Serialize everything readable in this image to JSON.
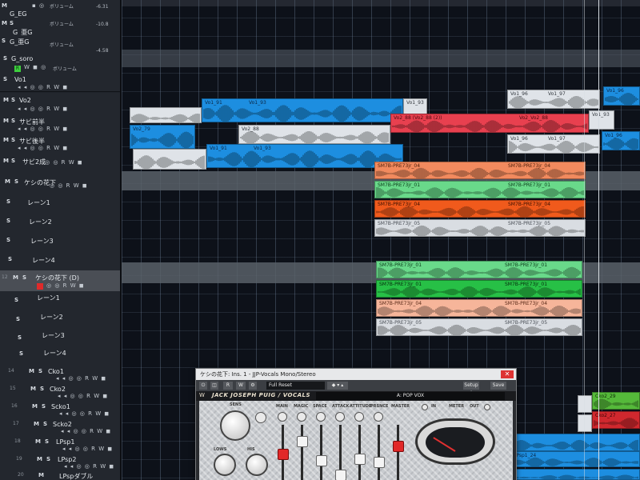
{
  "tracks": [
    {
      "name": "G_EG",
      "sub": "ボリューム",
      "value": "-6.31"
    },
    {
      "name": "G_亜G",
      "sub": "ボリューム",
      "value": "-10.8"
    },
    {
      "name": "G_亜G",
      "sub": "ボリューム",
      "value": "-4.58"
    },
    {
      "name": "G_soro",
      "sub": "ボリューム"
    },
    {
      "name": "Vo1"
    },
    {
      "name": "Vo2"
    },
    {
      "name": "サビ前半"
    },
    {
      "name": "サビ後半"
    },
    {
      "name": "サビ2成"
    },
    {
      "name": "ケシの花下"
    },
    {
      "name": "レーン1"
    },
    {
      "name": "レーン2"
    },
    {
      "name": "レーン3"
    },
    {
      "name": "レーン4"
    },
    {
      "name": "ケシの花下 (D)",
      "num": "12"
    },
    {
      "name": "レーン1"
    },
    {
      "name": "レーン2"
    },
    {
      "name": "レーン3"
    },
    {
      "name": "レーン4"
    },
    {
      "name": "Cko1",
      "num": "14"
    },
    {
      "name": "Cko2",
      "num": "15"
    },
    {
      "name": "Scko1",
      "num": "16"
    },
    {
      "name": "Scko2",
      "num": "17"
    },
    {
      "name": "LPsp1",
      "num": "18"
    },
    {
      "name": "LPsp2",
      "num": "19"
    },
    {
      "name": "LPspダブル",
      "num": "20"
    }
  ],
  "track_buttons": {
    "mute": "M",
    "solo": "S",
    "read": "R",
    "write": "W",
    "rec_lamp": "R"
  },
  "clips": [
    {
      "label": "Vo1_91",
      "label2": "Vo1_93"
    },
    {
      "label": "Vo1_93"
    },
    {
      "label": "Vo1_96",
      "label2": "Vo1_97"
    },
    {
      "label": "Vo1_96"
    },
    {
      "label": "Vo2_79"
    },
    {
      "label": "Vo2_88"
    },
    {
      "label": "Vo2_88 (Vo2_88 (2))",
      "label2": "Vo2_Vo2_88"
    },
    {
      "label": "Vo1_93"
    },
    {
      "label": "Vo1_91",
      "label2": "Vo1_93"
    },
    {
      "label": "Vo1_96",
      "label2": "Vo1_97"
    },
    {
      "label": "Vo1_96"
    },
    {
      "label": "SM7B-PRE73jr_04",
      "label2": "SM7B-PRE73jr_04"
    },
    {
      "label": "SM7B-PRE73jr_01",
      "label2": "SM7B-PRE73jr_01"
    },
    {
      "label": "SM7B-PRE73jr_04",
      "label2": "SM7B-PRE73jr_04"
    },
    {
      "label": "SM7B-PRE73jr_05",
      "label2": "SM7B-PRE73jr_05"
    },
    {
      "label": "SM7B-PRE73jr_01",
      "label2": "SM7B-PRE73jr_01"
    },
    {
      "label": "SM7B-PRE73jr_01",
      "label2": "SM7B-PRE73jr_01"
    },
    {
      "label": "SM7B-PRE73jr_04",
      "label2": "SM7B-PRE73jr_04"
    },
    {
      "label": "SM7B-PRE73jr_05",
      "label2": "SM7B-PRE73jr_05"
    },
    {
      "label": "Cko2_29"
    },
    {
      "label": "Cko2_27"
    },
    {
      "label": "LPsp1_24"
    }
  ],
  "plugin": {
    "window_title": "ケシの花下: Ins. 1 - JJP-Vocals Mono/Stereo",
    "close": "✕",
    "tool_buttons": [
      "R",
      "W",
      "⚙"
    ],
    "preset_field": "Full Reset",
    "right_buttons": [
      "Setup A",
      "Save"
    ],
    "brand": "JACK JOSEPH PUIG / VOCALS",
    "preset_name": "A: POP VOX",
    "controls": [
      "MAIN",
      "MAGIC",
      "SPACE",
      "ATTACK",
      "ATTITUDE",
      "PRSNCE",
      "MASTER"
    ],
    "right_labels": [
      "IN",
      "METER",
      "OUT"
    ],
    "left_labels": [
      "SENS",
      "LOWS",
      "HIS"
    ]
  },
  "colors": {
    "blue": "#1d8ee0",
    "red": "#e8404f",
    "orange": "#f28a5e",
    "green": "#69d98a"
  }
}
